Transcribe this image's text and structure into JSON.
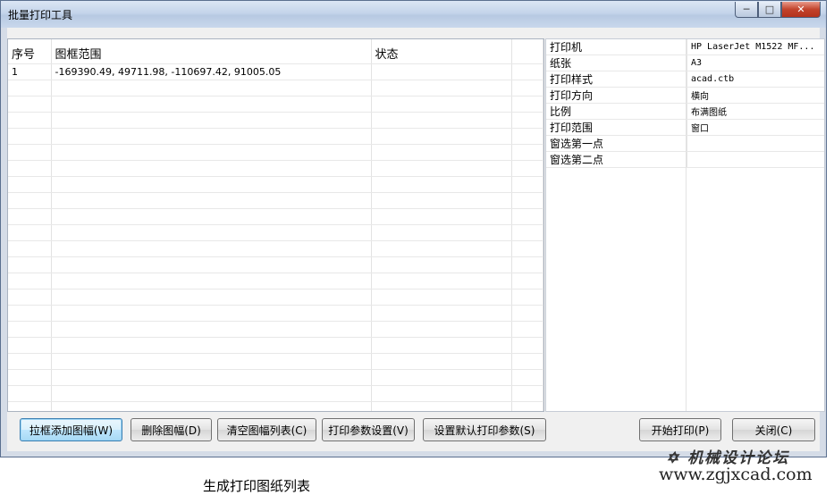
{
  "window": {
    "title": "批量打印工具",
    "minimize_icon": "minimize-icon",
    "maximize_icon": "maximize-icon",
    "close_icon": "close-icon"
  },
  "list": {
    "columns": [
      "序号",
      "图框范围",
      "状态",
      ""
    ],
    "rows": [
      {
        "index": "1",
        "range": "-169390.49, 49711.98, -110697.42, 91005.05",
        "status": ""
      }
    ]
  },
  "settings": [
    {
      "key": "打印机",
      "value": "HP LaserJet M1522 MF..."
    },
    {
      "key": "纸张",
      "value": "A3"
    },
    {
      "key": "打印样式",
      "value": "acad.ctb"
    },
    {
      "key": "打印方向",
      "value": "横向"
    },
    {
      "key": "比例",
      "value": "布满图纸"
    },
    {
      "key": "打印范围",
      "value": "窗口"
    },
    {
      "key": "窗选第一点",
      "value": ""
    },
    {
      "key": "窗选第二点",
      "value": ""
    }
  ],
  "buttons": {
    "add_frame": "拉框添加图幅(W)",
    "delete_frame": "删除图幅(D)",
    "clear_list": "清空图幅列表(C)",
    "print_settings": "打印参数设置(V)",
    "default_settings": "设置默认打印参数(S)",
    "start_print": "开始打印(P)",
    "close": "关闭(C)"
  },
  "caption": "生成打印图纸列表",
  "watermark": {
    "name": "机械设计论坛",
    "url": "www.zgjxcad.com"
  }
}
